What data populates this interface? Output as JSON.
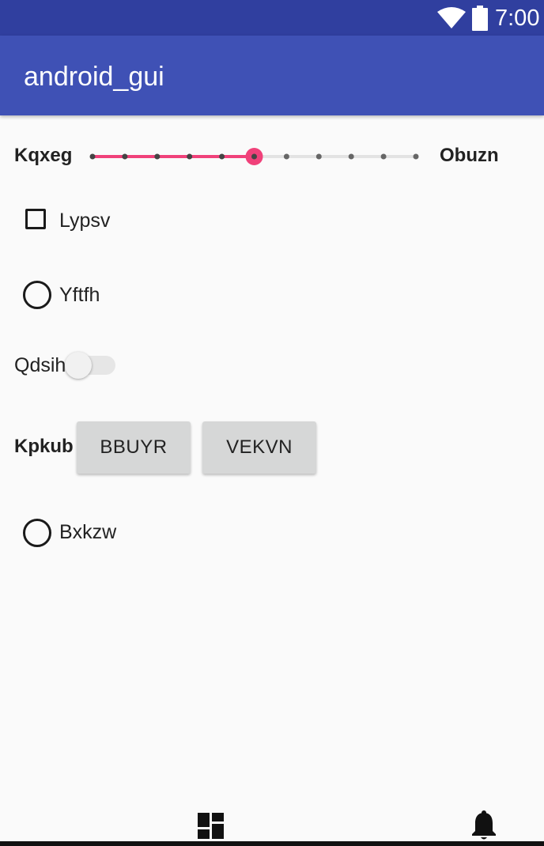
{
  "status_bar": {
    "time": "7:00",
    "wifi_icon": "wifi-icon",
    "battery_icon": "battery-icon",
    "background": "#303f9f"
  },
  "app_bar": {
    "title": "android_gui",
    "background": "#3f51b5"
  },
  "slider_row": {
    "start_label": "Kqxeg",
    "end_label": "Obuzn",
    "steps": 10,
    "value": 5,
    "accent_color": "#f0417a"
  },
  "checkbox": {
    "label": "Lypsv",
    "checked": false
  },
  "radio_1": {
    "label": "Yftfh",
    "checked": false
  },
  "switch": {
    "label": "Qdsih",
    "on": false
  },
  "button_row": {
    "label": "Kpkub",
    "buttons": [
      "BBUYR",
      "VEKVN"
    ]
  },
  "radio_2": {
    "label": "Bxkzw",
    "checked": false
  },
  "bottom_nav": {
    "items": [
      {
        "icon": "dashboard-icon"
      },
      {
        "icon": "notifications-icon"
      }
    ]
  }
}
